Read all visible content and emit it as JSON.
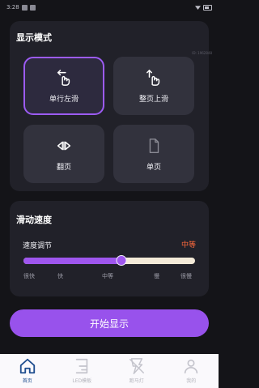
{
  "status_bar": {
    "time": "3:28"
  },
  "build_id": "ID: 1962848",
  "display_mode": {
    "title": "显示模式",
    "options": [
      {
        "label": "单行左滑",
        "icon": "swipe-left-icon",
        "selected": true
      },
      {
        "label": "整页上滑",
        "icon": "swipe-up-icon",
        "selected": false
      },
      {
        "label": "翻页",
        "icon": "page-flip-icon",
        "selected": false
      },
      {
        "label": "单页",
        "icon": "document-icon",
        "selected": false
      }
    ]
  },
  "speed": {
    "title": "滑动速度",
    "label": "速度调节",
    "value": "中等",
    "slider_level": 0.57,
    "ticks": [
      "很快",
      "快",
      "中等",
      "慢",
      "很慢"
    ]
  },
  "start_button": {
    "label": "开始显示"
  },
  "bottom_nav": {
    "items": [
      {
        "label": "首页",
        "icon": "home-icon",
        "active": true
      },
      {
        "label": "LED模板",
        "icon": "led-template-icon",
        "active": false
      },
      {
        "label": "跑马灯",
        "icon": "marquee-icon",
        "active": false
      },
      {
        "label": "我的",
        "icon": "profile-icon",
        "active": false
      }
    ]
  },
  "colors": {
    "accent": "#9c5bf2",
    "background": "#141418",
    "card": "#212129",
    "tile": "#32323d",
    "speed_value": "#ff6a3d",
    "nav_active": "#1f4e8f"
  }
}
